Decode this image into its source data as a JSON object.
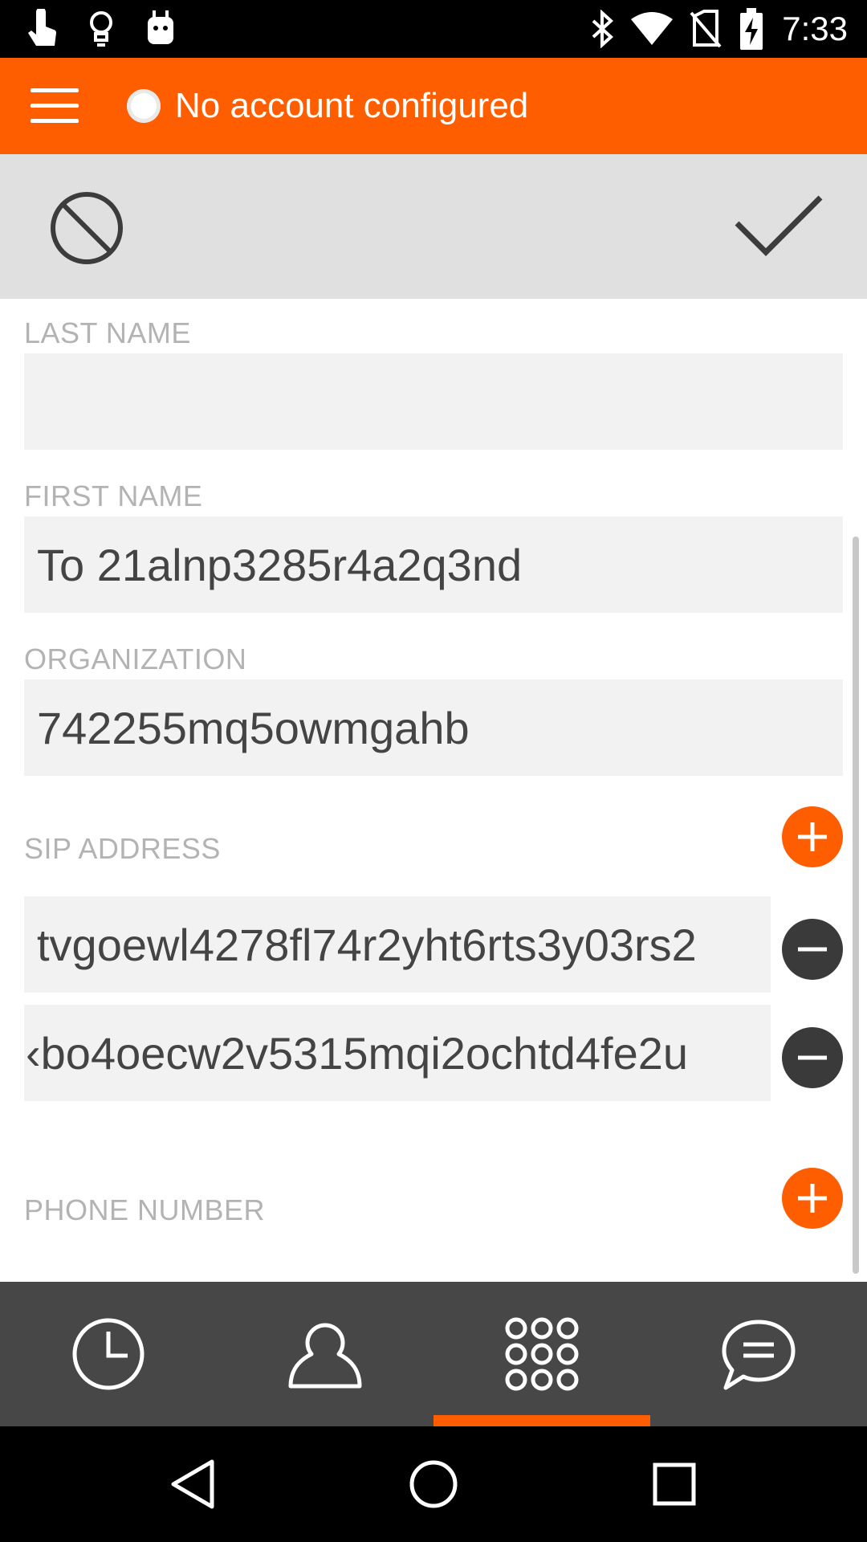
{
  "status_bar": {
    "time": "7:33",
    "left_icons": [
      "touch-icon",
      "lightbulb-icon",
      "android-icon"
    ],
    "right_icons": [
      "bluetooth-icon",
      "wifi-icon",
      "no-sim-icon",
      "battery-charging-icon"
    ]
  },
  "app_bar": {
    "menu_icon": "hamburger-menu-icon",
    "account_status": "No account configured",
    "accent_color": "#ff5e00"
  },
  "action_bar": {
    "cancel_icon": "cancel-icon",
    "confirm_icon": "checkmark-icon"
  },
  "form": {
    "last_name": {
      "label": "LAST NAME",
      "value": ""
    },
    "first_name": {
      "label": "FIRST NAME",
      "value": "To 21alnp3285r4a2q3nd"
    },
    "organization": {
      "label": "ORGANIZATION",
      "value": "742255mq5owmgahb"
    },
    "sip_address": {
      "label": "SIP ADDRESS",
      "entries": [
        {
          "value": "tvgoewl4278fl74r2yht6rts3y03rs2"
        },
        {
          "value": "‹bo4oecw2v5315mqi2ochtd4fe2u"
        }
      ]
    },
    "phone_number": {
      "label": "PHONE NUMBER"
    }
  },
  "tabs": [
    {
      "icon": "history-clock-icon",
      "selected": false
    },
    {
      "icon": "contacts-person-icon",
      "selected": false
    },
    {
      "icon": "dialpad-icon",
      "selected": true
    },
    {
      "icon": "chat-icon",
      "selected": false
    }
  ],
  "nav_bar": {
    "icons": [
      "back-icon",
      "home-icon",
      "recents-icon"
    ]
  }
}
